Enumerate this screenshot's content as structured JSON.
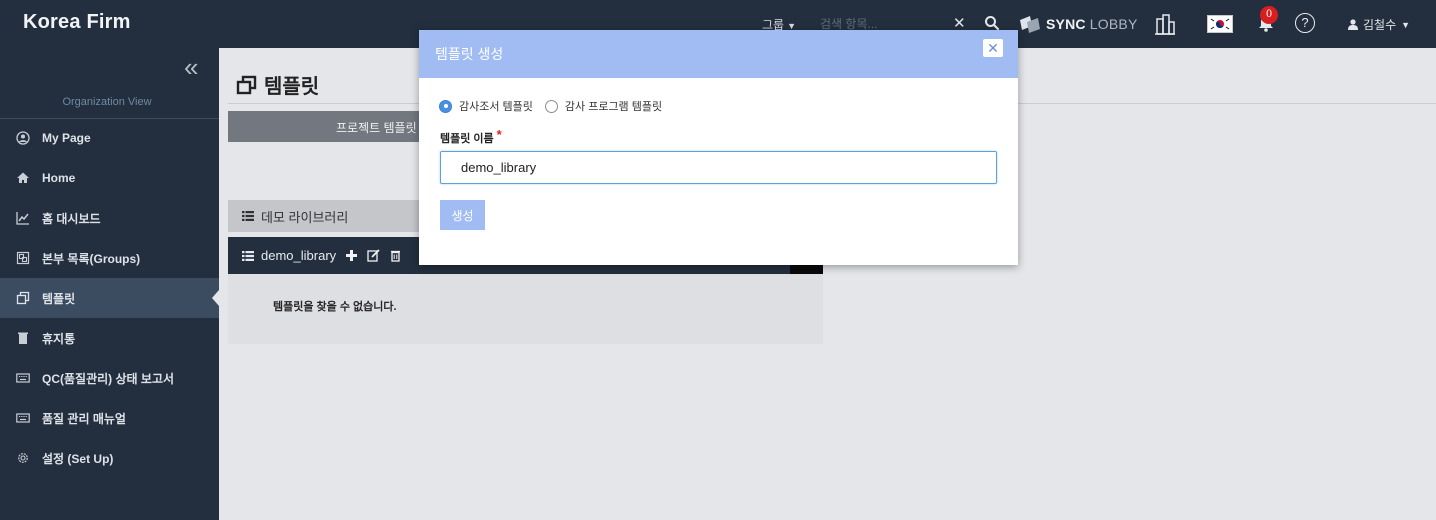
{
  "app": {
    "brand": "Korea Firm"
  },
  "topbar": {
    "group_label": "그룹",
    "search_placeholder": "검색 항목...",
    "sync_bold": "SYNC",
    "sync_light": "LOBBY",
    "notification_count": "0",
    "help_symbol": "?",
    "user_name": "김철수"
  },
  "sidebar": {
    "org_view_label": "Organization View",
    "items": [
      {
        "label": "My Page",
        "icon": "user-circle-icon"
      },
      {
        "label": "Home",
        "icon": "home-icon"
      },
      {
        "label": "홈 대시보드",
        "icon": "line-chart-icon"
      },
      {
        "label": "본부 목록(Groups)",
        "icon": "object-group-icon"
      },
      {
        "label": "템플릿",
        "icon": "clone-icon",
        "active": true
      },
      {
        "label": "휴지통",
        "icon": "trash-icon"
      },
      {
        "label": "QC(품질관리) 상태 보고서",
        "icon": "keyboard-icon"
      },
      {
        "label": "품질 관리 매뉴얼",
        "icon": "keyboard-icon"
      },
      {
        "label": "설정 (Set Up)",
        "icon": "gear-icon"
      }
    ]
  },
  "main": {
    "page_title": "템플릿",
    "tab_label": "프로젝트 템플릿",
    "library_header": "데모 라이브러리",
    "library_row_name": "demo_library",
    "empty_message": "템플릿을 찾을 수 없습니다."
  },
  "modal": {
    "title": "템플릿 생성",
    "close_symbol": "✕",
    "radio_options": [
      {
        "label": "감사조서 템플릿",
        "selected": true
      },
      {
        "label": "감사 프로그램 템플릿",
        "selected": false
      }
    ],
    "field_label": "템플릿 이름",
    "required_mark": "*",
    "name_value": "demo_library",
    "create_label": "생성"
  },
  "colors": {
    "nav_bg": "#232f3e",
    "modal_header": "#a0bcf2",
    "accent_blue": "#4a90e2",
    "badge_red": "#d81e1e"
  }
}
